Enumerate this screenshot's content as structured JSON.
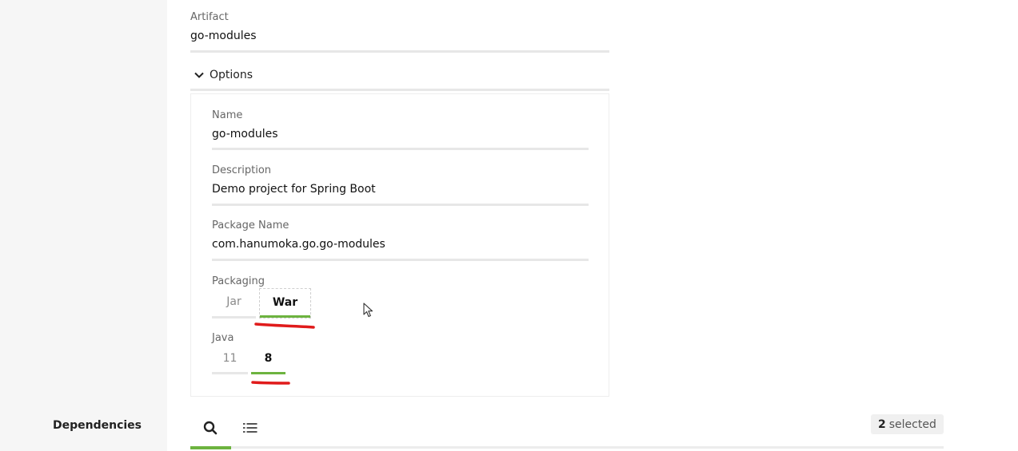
{
  "sidebar": {
    "dependencies_label": "Dependencies"
  },
  "artifact": {
    "label": "Artifact",
    "value": "go-modules"
  },
  "options": {
    "toggle_label": "Options",
    "name": {
      "label": "Name",
      "value": "go-modules"
    },
    "description": {
      "label": "Description",
      "value": "Demo project for Spring Boot"
    },
    "package_name": {
      "label": "Package Name",
      "value": "com.hanumoka.go.go-modules"
    },
    "packaging": {
      "label": "Packaging",
      "options": [
        "Jar",
        "War"
      ],
      "selected": "War"
    },
    "java": {
      "label": "Java",
      "options": [
        "11",
        "8"
      ],
      "selected": "8"
    }
  },
  "dependencies": {
    "tabs": [
      "search-icon",
      "list-icon"
    ],
    "active_tab": "search-icon",
    "selected_count": "2",
    "selected_suffix": "selected"
  },
  "colors": {
    "accent_green": "#6db33f",
    "annotation_red": "#e01b1b",
    "sidebar_bg": "#f6f6f6"
  }
}
